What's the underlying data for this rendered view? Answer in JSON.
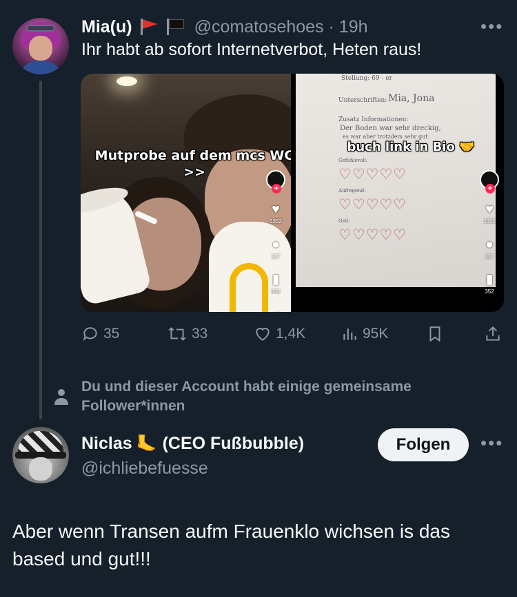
{
  "tweet1": {
    "author_name": "Mia(u)",
    "flag1_icon": "red-flag-icon",
    "flag2_icon": "black-flag-icon",
    "handle_time": "@comatosehoes · 19h",
    "text": "Ihr habt ab sofort Internetverbot, Heten raus!",
    "media": {
      "left_overlay": "Mutprobe auf dem mcs WC >>",
      "left_stats": [
        "3352",
        "117",
        "352"
      ],
      "right_overlay": "buch link in Bio 🤝",
      "right_stats": [
        "3352",
        "117",
        "352"
      ],
      "paper_lines": [
        "Stellung: 69 - er",
        "Unterschriften:",
        "Mia, Jona",
        "Zusatz Informationen:",
        "Der Boden war sehr dreckig,",
        "es war aber trotzdem sehr gut",
        "Gefühlsvoll:",
        "Aufregend:",
        "Geil:"
      ]
    },
    "actions": {
      "replies": "35",
      "retweets": "33",
      "likes": "1,4K",
      "views": "95K"
    }
  },
  "mutual_text": "Du und dieser Account habt einige gemeinsame Follower*innen",
  "tweet2": {
    "author_name_a": "Niclas",
    "foot_emoji": "🦶",
    "author_name_b": "(CEO Fußbubble)",
    "handle": "@ichliebefuesse",
    "follow_label": "Folgen",
    "text": "Aber wenn Transen aufm Frauenklo wichsen is das based und gut!!!"
  },
  "more_label": "•••",
  "colors": {
    "background": "#15202b",
    "text_primary": "#f7f9f9",
    "text_secondary": "#8b98a5",
    "thread_line": "#38444d",
    "follow_bg": "#eff3f4"
  }
}
